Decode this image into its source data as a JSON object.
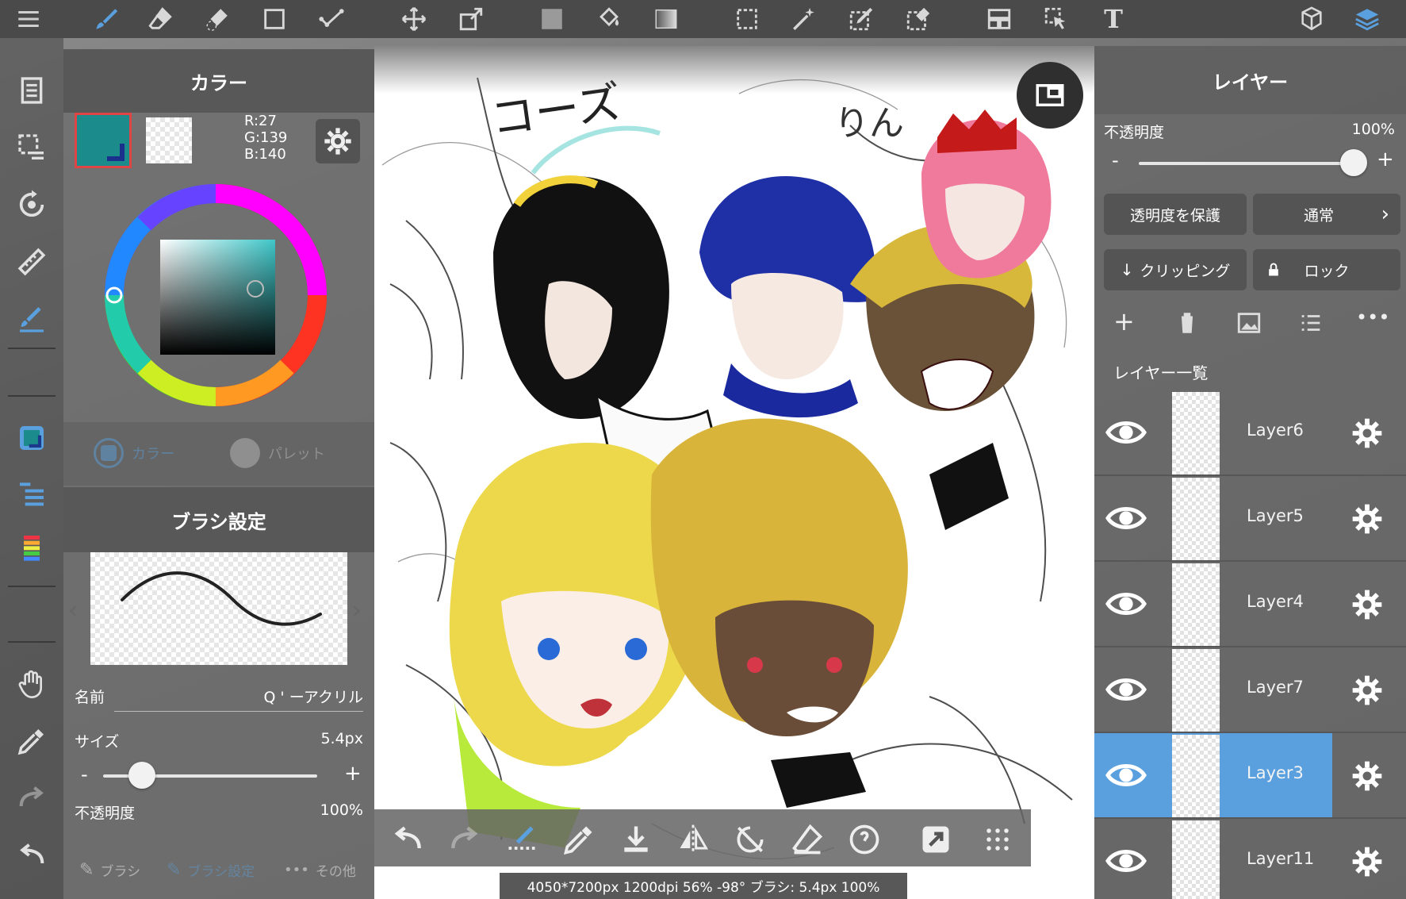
{
  "colors": {
    "accent": "#5aa0de",
    "current_color": "#1b8b8c",
    "panel": "#6e6e6e",
    "toolbar": "#4a4a4a"
  },
  "toolbar": {
    "icons": [
      "menu-icon",
      "brush-icon",
      "eraser-icon",
      "smudge-icon",
      "square-icon",
      "check-icon",
      "move-icon",
      "transform-icon",
      "fill-color-icon",
      "bucket-icon",
      "gradient-icon",
      "select-rect-icon",
      "magic-wand-icon",
      "select-pen-icon",
      "select-eraser-icon",
      "frame-icon",
      "select-arrow-icon",
      "text-icon",
      "3d-icon",
      "layers-icon"
    ],
    "text_tool_label": "T"
  },
  "color_panel": {
    "title": "カラー",
    "r": "R:27",
    "g": "G:139",
    "b": "B:140",
    "tab_color": "カラー",
    "tab_palette": "パレット"
  },
  "brush_panel": {
    "title": "ブラシ設定",
    "name_label": "名前",
    "name_value": "Q ' ーアクリル",
    "size_label": "サイズ",
    "size_value": "5.4px",
    "opacity_label": "不透明度",
    "opacity_value": "100%",
    "minus": "-",
    "plus": "+",
    "tab_brush": "ブラシ",
    "tab_brush_settings": "ブラシ設定",
    "tab_other": "その他",
    "size_fraction": 0.18
  },
  "layer_panel": {
    "title": "レイヤー",
    "opacity_label": "不透明度",
    "opacity_value": "100%",
    "minus": "-",
    "plus": "+",
    "protect_alpha": "透明度を保護",
    "blend_mode": "通常",
    "clipping": "クリッピング",
    "lock": "ロック",
    "list_title": "レイヤー一覧",
    "layers": [
      {
        "name": "Layer6",
        "selected": false
      },
      {
        "name": "Layer5",
        "selected": false
      },
      {
        "name": "Layer4",
        "selected": false
      },
      {
        "name": "Layer7",
        "selected": false
      },
      {
        "name": "Layer3",
        "selected": true
      },
      {
        "name": "Layer11",
        "selected": false
      }
    ]
  },
  "canvas": {
    "text1": "コーズ",
    "text2": "りん"
  },
  "status_bar": {
    "text": "4050*7200px 1200dpi 56% -98° ブラシ: 5.4px 100%"
  }
}
